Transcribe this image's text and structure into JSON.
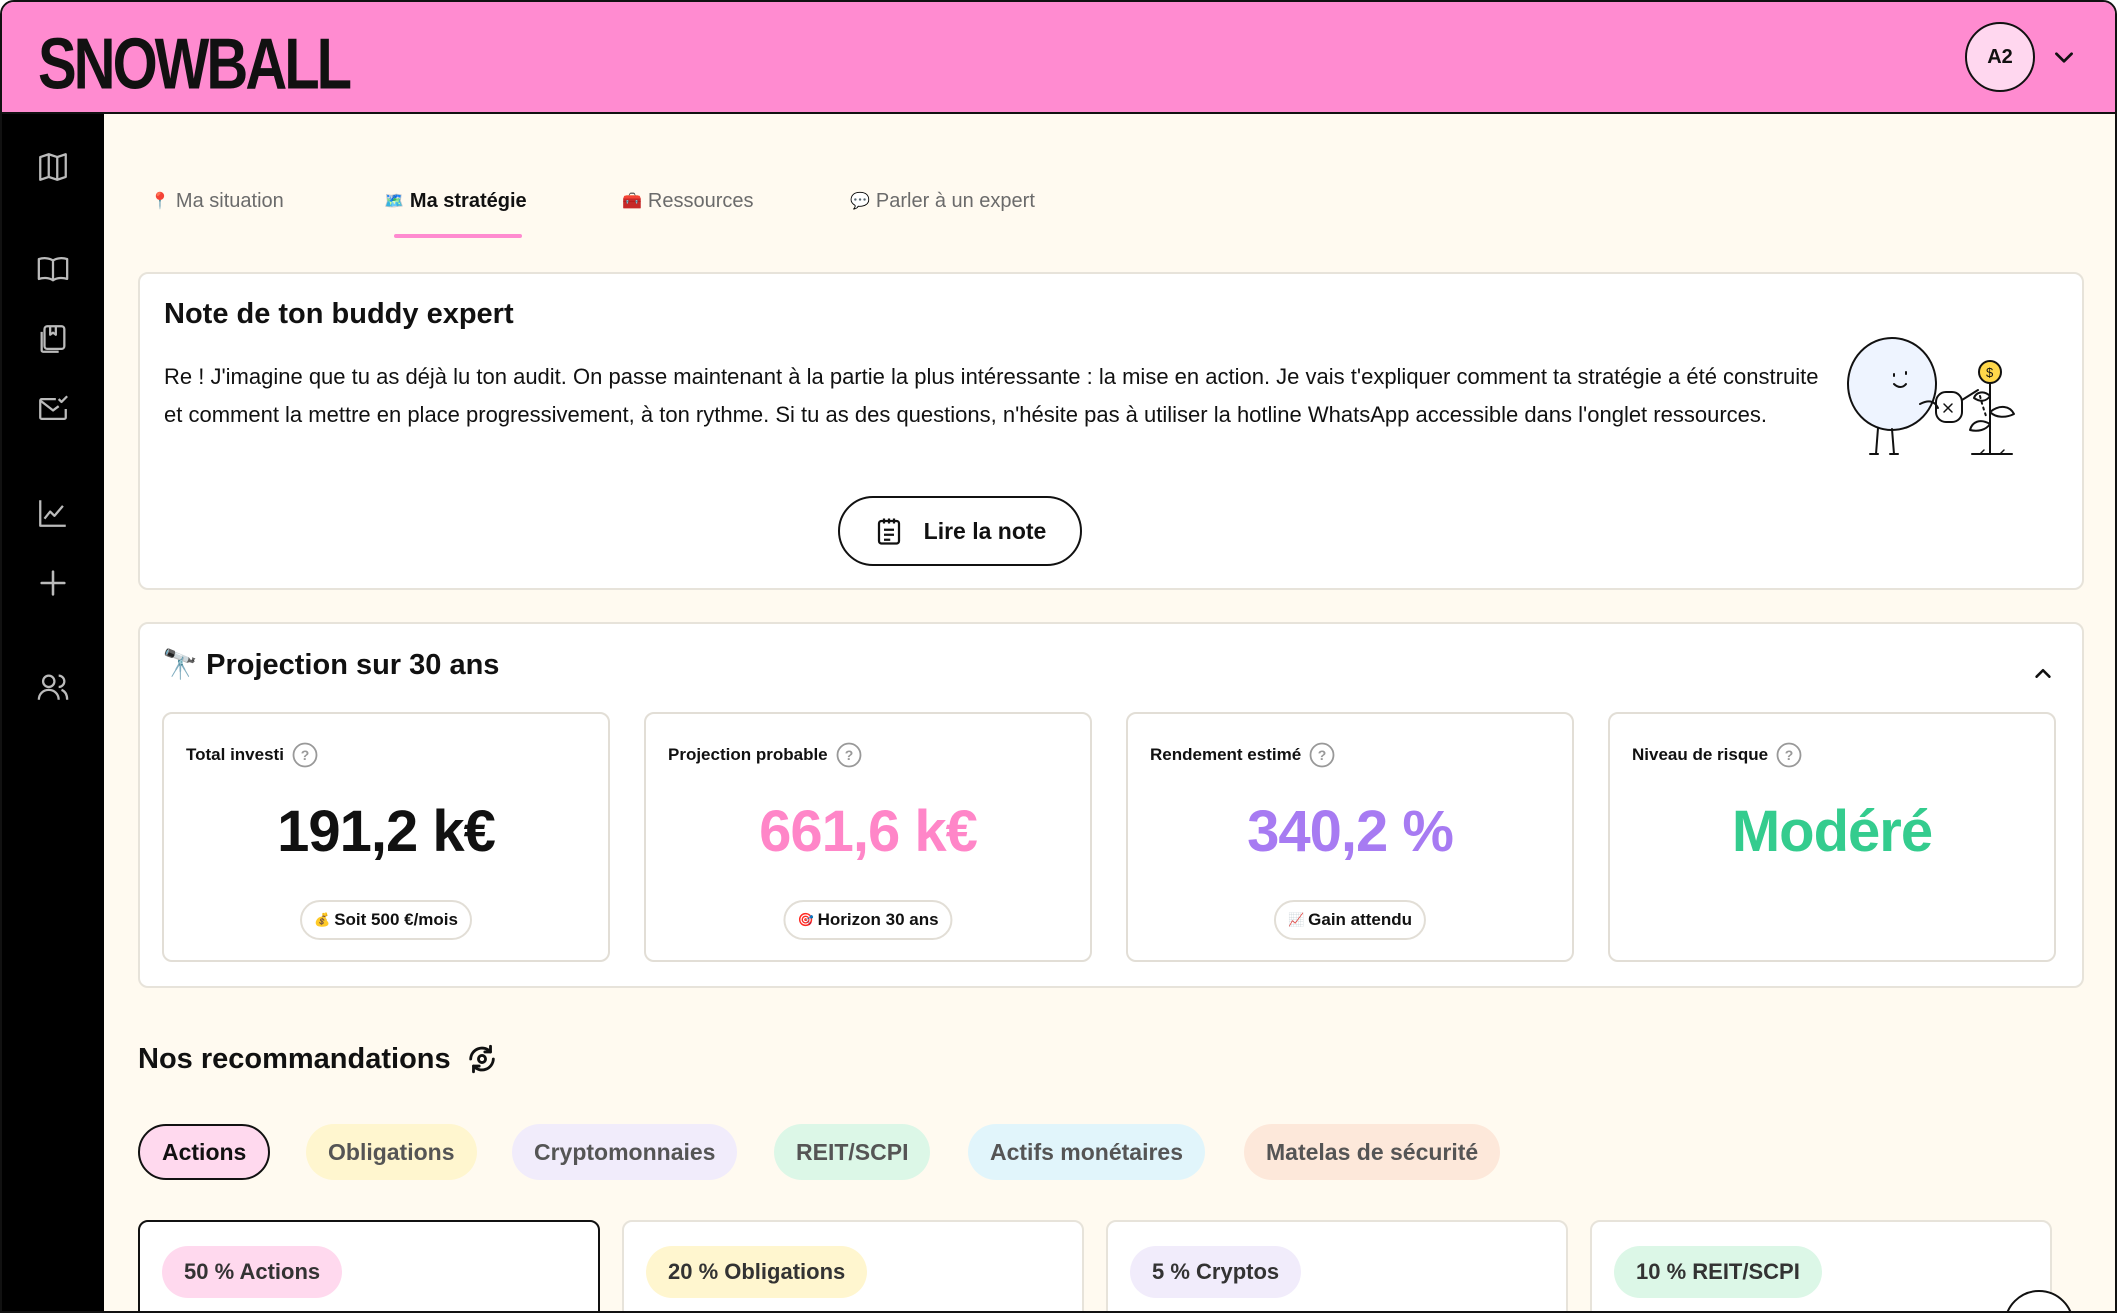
{
  "app": {
    "logo": "SNOWBALL",
    "avatar_initials": "A2"
  },
  "tabs": [
    {
      "label": "Ma situation",
      "emoji": "📍"
    },
    {
      "label": "Ma stratégie",
      "emoji": "🗺️"
    },
    {
      "label": "Ressources",
      "emoji": "🧰"
    },
    {
      "label": "Parler à un expert",
      "emoji": "💬"
    }
  ],
  "note": {
    "title": "Note de ton buddy expert",
    "body": "Re ! J'imagine que tu as déjà lu ton audit. On passe maintenant à la partie la plus intéressante : la mise en action. Je vais t'expliquer comment ta stratégie a été construite et comment la mettre en place progressivement, à ton rythme. Si tu as des questions, n'hésite pas à utiliser la hotline WhatsApp accessible dans l'onglet ressources.",
    "button_label": "Lire la note"
  },
  "projection": {
    "emoji": "🔭",
    "title": "Projection sur 30 ans",
    "stats": [
      {
        "label": "Total investi",
        "value": "191,2 k€",
        "color": "#111111",
        "pill_emoji": "💰",
        "pill": "Soit 500 €/mois"
      },
      {
        "label": "Projection probable",
        "value": "661,6 k€",
        "color": "#ff86c8",
        "pill_emoji": "🎯",
        "pill": "Horizon 30 ans"
      },
      {
        "label": "Rendement estimé",
        "value": "340,2 %",
        "color": "#a77bf2",
        "pill_emoji": "📈",
        "pill": "Gain attendu"
      },
      {
        "label": "Niveau de risque",
        "value": "Modéré",
        "color": "#34cc8e"
      }
    ]
  },
  "recommendations": {
    "title": "Nos recommandations",
    "chips": [
      {
        "label": "Actions",
        "bg": "#ffd9ee"
      },
      {
        "label": "Obligations",
        "bg": "#fff6cf"
      },
      {
        "label": "Cryptomonnaies",
        "bg": "#f1ecfb"
      },
      {
        "label": "REIT/SCPI",
        "bg": "#dcf7e7"
      },
      {
        "label": "Actifs monétaires",
        "bg": "#e1f5fb"
      },
      {
        "label": "Matelas de sécurité",
        "bg": "#fde8da"
      }
    ],
    "allocations": [
      {
        "label": "50 % Actions",
        "bg": "#ffd9ee"
      },
      {
        "label": "20 % Obligations",
        "bg": "#fff6cf"
      },
      {
        "label": "5 % Cryptos",
        "bg": "#f1ecfb"
      },
      {
        "label": "10 % REIT/SCPI",
        "bg": "#dcf7e7"
      }
    ]
  }
}
